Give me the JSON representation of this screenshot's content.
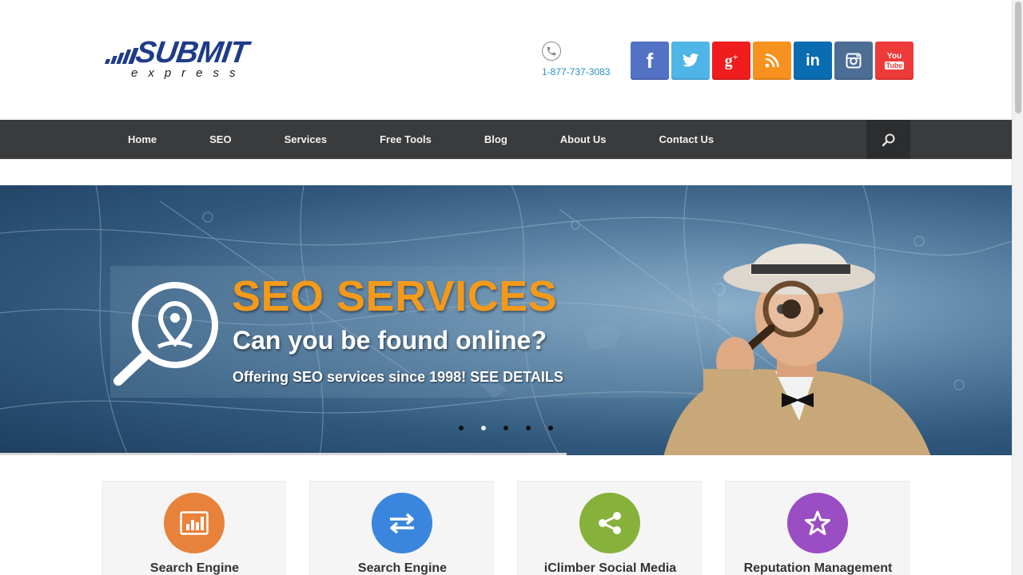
{
  "header": {
    "logo": {
      "word": "SUBMIT",
      "sub": "express"
    },
    "phone": {
      "icon": "phone-icon",
      "number": "1-877-737-3083"
    },
    "socials": [
      {
        "name": "facebook",
        "glyph": "f",
        "color": "#5472c4"
      },
      {
        "name": "twitter",
        "glyph": "twitter-bird",
        "color": "#4fb4e6"
      },
      {
        "name": "google-plus",
        "glyph": "g+",
        "color": "#ef1d1d"
      },
      {
        "name": "rss",
        "glyph": "rss",
        "color": "#f7921e"
      },
      {
        "name": "linkedin",
        "glyph": "in",
        "color": "#0a6cb1"
      },
      {
        "name": "instagram",
        "glyph": "camera",
        "color": "#4c6d94"
      },
      {
        "name": "youtube",
        "glyph": "You",
        "color": "#ef3a3a"
      }
    ]
  },
  "nav": {
    "items": [
      {
        "label": "Home"
      },
      {
        "label": "SEO"
      },
      {
        "label": "Services"
      },
      {
        "label": "Free Tools"
      },
      {
        "label": "Blog"
      },
      {
        "label": "About Us"
      },
      {
        "label": "Contact Us"
      }
    ],
    "search_icon": "search-icon"
  },
  "hero": {
    "title": "SEO SERVICES",
    "subtitle": "Can you be found online?",
    "tagline": "Offering SEO services since 1998! SEE DETAILS",
    "dots": 5,
    "active_dot": 1,
    "progress": 0.56
  },
  "cards": [
    {
      "title": "Search Engine",
      "icon": "bar-chart-icon",
      "color": "#e8823a"
    },
    {
      "title": "Search Engine",
      "icon": "swap-arrows-icon",
      "color": "#3a86de"
    },
    {
      "title": "iClimber Social Media",
      "icon": "share-icon",
      "color": "#86b13a"
    },
    {
      "title": "Reputation Management",
      "icon": "star-icon",
      "color": "#9b4dc4"
    }
  ],
  "colors": {
    "nav_bg": "#3a3b3d",
    "accent_orange": "#f39a1b",
    "brand_blue": "#1e3b8a",
    "phone_link": "#2a8fc7"
  }
}
